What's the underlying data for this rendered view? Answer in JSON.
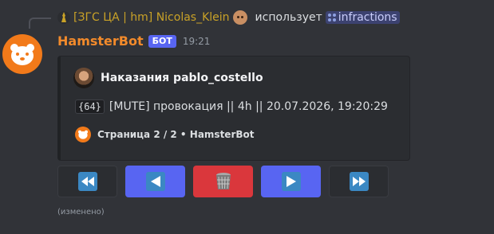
{
  "reply": {
    "author": "[ЗГС ЦА | hm] Nicolas_Klein",
    "action": "использует",
    "command": "infractions"
  },
  "message": {
    "username": "HamsterBot",
    "bot_tag": "БОТ",
    "time": "19:21",
    "edited_label": "(изменено)"
  },
  "embed": {
    "author": "Наказания pablo_costello",
    "entry_id": "{64}",
    "entry_text": "[MUTE] провокация || 4h || 20.07.2026, 19:20:29",
    "footer": "Страница 2 / 2 • HamsterBot"
  },
  "buttons": [
    {
      "icon": "fast-backward-icon",
      "style": "grey"
    },
    {
      "icon": "previous-icon",
      "style": "blue"
    },
    {
      "icon": "wastebasket-icon",
      "style": "red"
    },
    {
      "icon": "next-icon",
      "style": "blue"
    },
    {
      "icon": "fast-forward-icon",
      "style": "grey"
    }
  ],
  "colors": {
    "background": "#313338",
    "username": "#f28a2b",
    "bot_tag": "#5865f2",
    "blurple": "#5865f2",
    "danger": "#da373c",
    "embed_bg": "#2b2d31"
  }
}
